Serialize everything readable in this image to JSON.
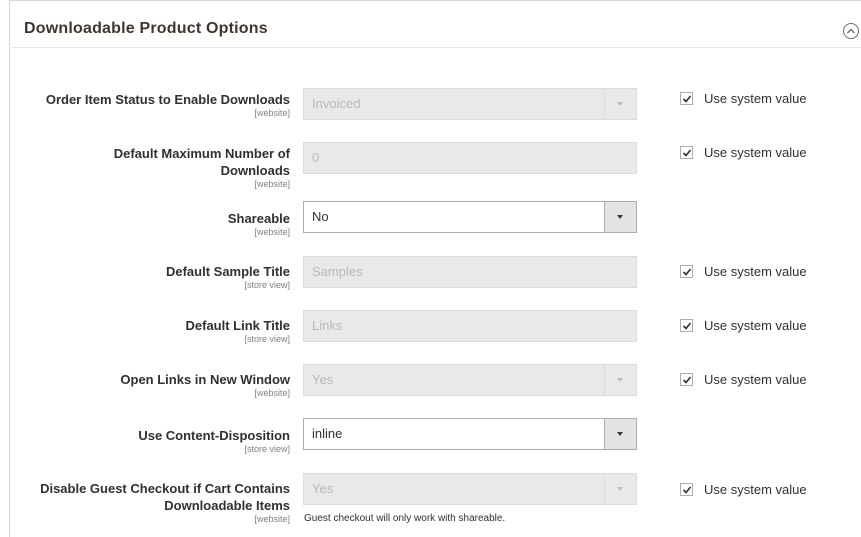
{
  "section": {
    "title": "Downloadable Product Options",
    "collapse_icon": "chevron-up-circle-icon"
  },
  "use_system_label": "Use system value",
  "fields": [
    {
      "label": "Order Item Status to Enable Downloads",
      "scope": "[website]",
      "value": "Invoiced",
      "type": "select",
      "disabled": true,
      "use_system": true
    },
    {
      "label_lines": [
        "Default Maximum Number of",
        "Downloads"
      ],
      "scope": "[website]",
      "value": "0",
      "type": "input",
      "disabled": true,
      "use_system": true
    },
    {
      "label": "Shareable",
      "scope": "[website]",
      "value": "No",
      "type": "select",
      "disabled": false,
      "use_system": false
    },
    {
      "label": "Default Sample Title",
      "scope": "[store view]",
      "value": "Samples",
      "type": "input",
      "disabled": true,
      "use_system": true
    },
    {
      "label": "Default Link Title",
      "scope": "[store view]",
      "value": "Links",
      "type": "input",
      "disabled": true,
      "use_system": true
    },
    {
      "label": "Open Links in New Window",
      "scope": "[website]",
      "value": "Yes",
      "type": "select",
      "disabled": true,
      "use_system": true
    },
    {
      "label": "Use Content-Disposition",
      "scope": "[store view]",
      "value": "inline",
      "type": "select",
      "disabled": false,
      "use_system": false
    },
    {
      "label_lines": [
        "Disable Guest Checkout if Cart Contains",
        "Downloadable Items"
      ],
      "scope": "[website]",
      "value": "Yes",
      "type": "select",
      "disabled": true,
      "use_system": true,
      "note": "Guest checkout will only work with shareable."
    }
  ]
}
